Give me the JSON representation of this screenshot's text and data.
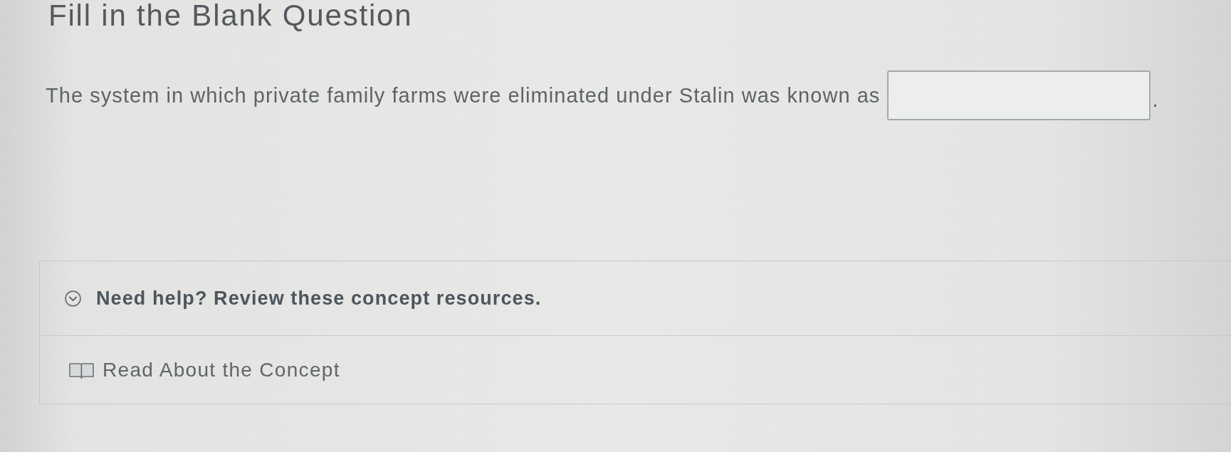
{
  "heading": "Fill in the Blank Question",
  "question": {
    "parts": [
      {
        "kind": "text",
        "text": "The system in which private family farms were eliminated under Stalin was known as"
      },
      {
        "kind": "blank"
      },
      {
        "kind": "text",
        "text": "."
      }
    ]
  },
  "help": {
    "expanded": true,
    "title": "Need help? Review these concept resources.",
    "resources": [
      {
        "kind": "reading",
        "label": "Read About the Concept"
      }
    ]
  }
}
